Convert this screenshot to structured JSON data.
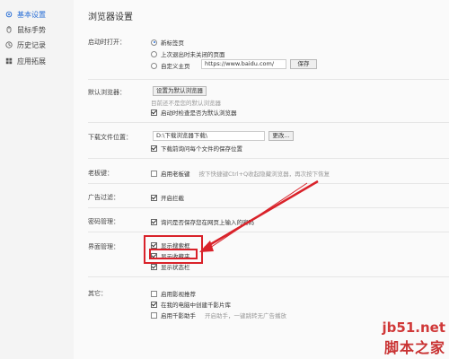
{
  "sidebar": {
    "items": [
      {
        "label": "基本设置",
        "icon": "gear-icon"
      },
      {
        "label": "鼠标手势",
        "icon": "mouse-icon"
      },
      {
        "label": "历史记录",
        "icon": "clock-icon"
      },
      {
        "label": "应用拓展",
        "icon": "grid-icon"
      }
    ]
  },
  "main": {
    "title": "浏览器设置",
    "startup": {
      "label": "启动时打开：",
      "opt_new_tab": "新标签页",
      "opt_last_session": "上次退出时未关闭的页面",
      "opt_custom": "自定义主页",
      "homepage_value": "https://www.baidu.com/",
      "save_button": "保存"
    },
    "default_browser": {
      "label": "默认浏览器：",
      "set_button": "设置为默认浏览器",
      "status": "目前还不是您的默认浏览器",
      "auto_check": "启动时检查是否为默认浏览器"
    },
    "download": {
      "label": "下载文件位置：",
      "path_placeholder": "D:\\下载浏览器下载\\",
      "change_button": "更改...",
      "ask_each_time": "下载前询问每个文件的保存位置"
    },
    "boss_key": {
      "label": "老板键：",
      "enable": "启用老板键",
      "hint": "按下快捷键Ctrl+Q收起隐藏浏览器，再次按下恢复"
    },
    "ad_filter": {
      "label": "广告过滤：",
      "enable": "开启拦截"
    },
    "password": {
      "label": "密码管理：",
      "ask_save": "询问是否保存您在网页上输入的密码"
    },
    "ui": {
      "label": "界面管理：",
      "show_search_box": "显示搜索框",
      "show_favorites": "显示收藏夹",
      "show_status_bar": "显示状态栏"
    },
    "other": {
      "label": "其它：",
      "video_recommend": "启用影视推荐",
      "create_shortcut": "在我的电脑中创建千影片库",
      "qianying_helper": "启用千影助手",
      "qianying_hint": "开启助手，一键跳转无广告播放"
    }
  },
  "watermark": {
    "site": "jb51.net",
    "name": "脚本之家"
  },
  "colors": {
    "accent": "#2a6fd6",
    "annotation": "#d9222a"
  }
}
